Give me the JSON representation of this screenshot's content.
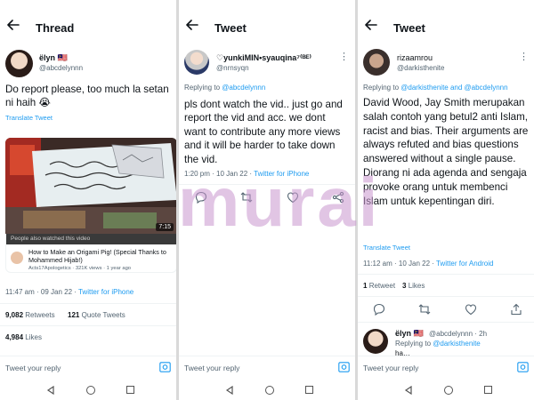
{
  "panel1": {
    "header_title": "Thread",
    "author_name": "ëlyn 🇲🇾",
    "author_handle": "@abcdelynnn",
    "tweet_text": "Do report please, too much la setan ni haih 😭",
    "translate_label": "Translate Tweet",
    "video": {
      "duration": "7:15",
      "watched_label": "People also watched this video",
      "title": "How to Make an Origami Pig! (Special Thanks to Mohammed Hijab!)",
      "channel_info": "Acts17Apologetics · 321K views · 1 year ago"
    },
    "timestamp": "11:47 am · 09 Jan 22 ·",
    "source": "Twitter for iPhone",
    "retweets_count": "9,082",
    "retweets_label": "Retweets",
    "quotes_count": "121",
    "quotes_label": "Quote Tweets",
    "likes_count": "4,984",
    "likes_label": "Likes",
    "reply_placeholder": "Tweet your reply"
  },
  "panel2": {
    "header_title": "Tweet",
    "author_name": "♡yunkiMIN•syauqina⁷⁽ᴮᴱ⁾",
    "author_handle": "@nrnsyqn",
    "replying_prefix": "Replying to",
    "replying_to": "@abcdelynnn",
    "tweet_text": "pls dont watch the vid.. just go and report the vid and acc. we dont want to contribute any more views and it will be harder to take down the vid.",
    "timestamp": "1:20 pm · 10 Jan 22 ·",
    "source": "Twitter for iPhone",
    "reply_placeholder": "Tweet your reply"
  },
  "panel3": {
    "header_title": "Tweet",
    "author_name": "rizaamrou",
    "author_handle": "@darkisthenite",
    "replying_prefix": "Replying to",
    "replying_to": "@darkisthenite and @abcdelynnn",
    "tweet_text": "David Wood, Jay Smith merupakan salah contoh yang betul2 anti Islam, racist and bias. Their arguments are always refuted and bias questions answered without a single pause. Diorang ni ada agenda and sengaja provoke orang untuk membenci Islam untuk kepentingan diri.",
    "translate_label": "Translate Tweet",
    "timestamp": "11:12 am · 10 Jan 22 ·",
    "source": "Twitter for Android",
    "retweet_count": "1",
    "retweet_label": "Retweet",
    "likes_count": "3",
    "likes_label": "Likes",
    "reply": {
      "author_name": "ëlyn 🇲🇾",
      "author_handle": "@abcdelynnn · 2h",
      "replying_prefix": "Replying to",
      "replying_to": "@darkisthenite",
      "partial_text": "ha…"
    },
    "reply_placeholder": "Tweet your reply"
  },
  "watermark": "murai",
  "colors": {
    "link": "#1d9bf0",
    "secondary_text": "#536471",
    "watermark": "#c896cd"
  }
}
